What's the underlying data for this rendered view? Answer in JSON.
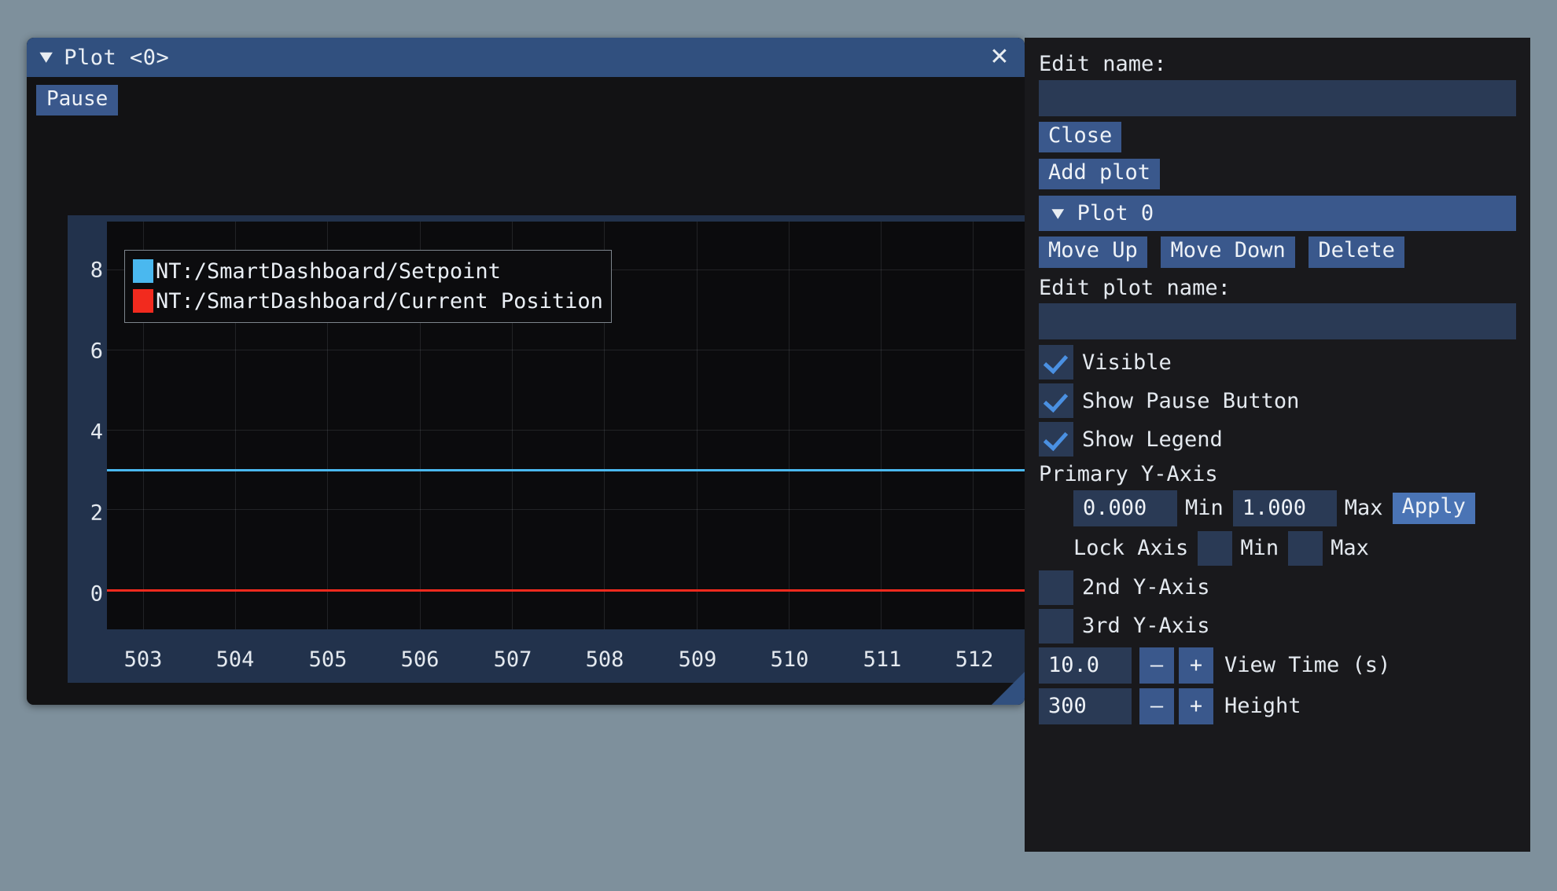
{
  "plot_window": {
    "title": "Plot <0>",
    "collapse_icon": "▼",
    "close_icon": "✕",
    "pause_label": "Pause"
  },
  "chart_data": {
    "type": "line",
    "title": "",
    "xlabel": "",
    "ylabel": "",
    "xlim": [
      502.6,
      512.6
    ],
    "ylim": [
      -1.0,
      9.2
    ],
    "x_ticks": [
      "503",
      "504",
      "505",
      "506",
      "507",
      "508",
      "509",
      "510",
      "511",
      "512"
    ],
    "x_tick_values": [
      503,
      504,
      505,
      506,
      507,
      508,
      509,
      510,
      511,
      512
    ],
    "y_ticks": [
      "8",
      "6",
      "4",
      "2",
      "0"
    ],
    "y_tick_values": [
      8,
      6,
      4,
      2,
      0
    ],
    "grid": true,
    "legend_position": "upper-left",
    "series": [
      {
        "name": "NT:/SmartDashboard/Setpoint",
        "color": "#4ab8ef",
        "constant_value": 3.0,
        "x": [
          503,
          504,
          505,
          506,
          507,
          508,
          509,
          510,
          511,
          512
        ],
        "values": [
          3,
          3,
          3,
          3,
          3,
          3,
          3,
          3,
          3,
          3
        ]
      },
      {
        "name": "NT:/SmartDashboard/Current Position",
        "color": "#f22a1e",
        "constant_value": 0.0,
        "x": [
          503,
          504,
          505,
          506,
          507,
          508,
          509,
          510,
          511,
          512
        ],
        "values": [
          0,
          0,
          0,
          0,
          0,
          0,
          0,
          0,
          0,
          0
        ]
      }
    ]
  },
  "settings_panel": {
    "edit_name_label": "Edit name:",
    "edit_name_value": "",
    "edit_name_placeholder": "",
    "close_label": "Close",
    "add_plot_label": "Add plot",
    "plot_section": {
      "collapse_icon": "▼",
      "title": "Plot 0",
      "move_up_label": "Move Up",
      "move_down_label": "Move Down",
      "delete_label": "Delete",
      "edit_plot_name_label": "Edit plot name:",
      "edit_plot_name_value": "",
      "edit_plot_name_placeholder": ""
    },
    "checkboxes": [
      {
        "label": "Visible",
        "checked": true
      },
      {
        "label": "Show Pause Button",
        "checked": true
      },
      {
        "label": "Show Legend",
        "checked": true
      }
    ],
    "primary_y_axis": {
      "heading": "Primary Y-Axis",
      "min_value": "0.000",
      "min_label": "Min",
      "max_value": "1.000",
      "max_label": "Max",
      "apply_label": "Apply",
      "lock_axis_label": "Lock Axis",
      "lock_min_label": "Min",
      "lock_max_label": "Max",
      "lock_min_checked": false,
      "lock_max_checked": false
    },
    "secondary_axes": [
      {
        "label": "2nd Y-Axis",
        "checked": false
      },
      {
        "label": "3rd Y-Axis",
        "checked": false
      }
    ],
    "steppers": [
      {
        "value": "10.0",
        "minus": "–",
        "plus": "+",
        "label": "View Time (s)"
      },
      {
        "value": "300",
        "minus": "–",
        "plus": "+",
        "label": "Height"
      }
    ]
  },
  "colors": {
    "desktop_background": "#7e909c",
    "titlebar": "#31507f",
    "button": "#3a588c",
    "button_accent": "#4a74b5",
    "input": "#2a3a55",
    "panel_background": "#19191c",
    "chart_background": "#0b0b0d",
    "axis_gutter": "#22324c",
    "checkmark": "#4a90e2",
    "series_1": "#4ab8ef",
    "series_2": "#f22a1e"
  }
}
